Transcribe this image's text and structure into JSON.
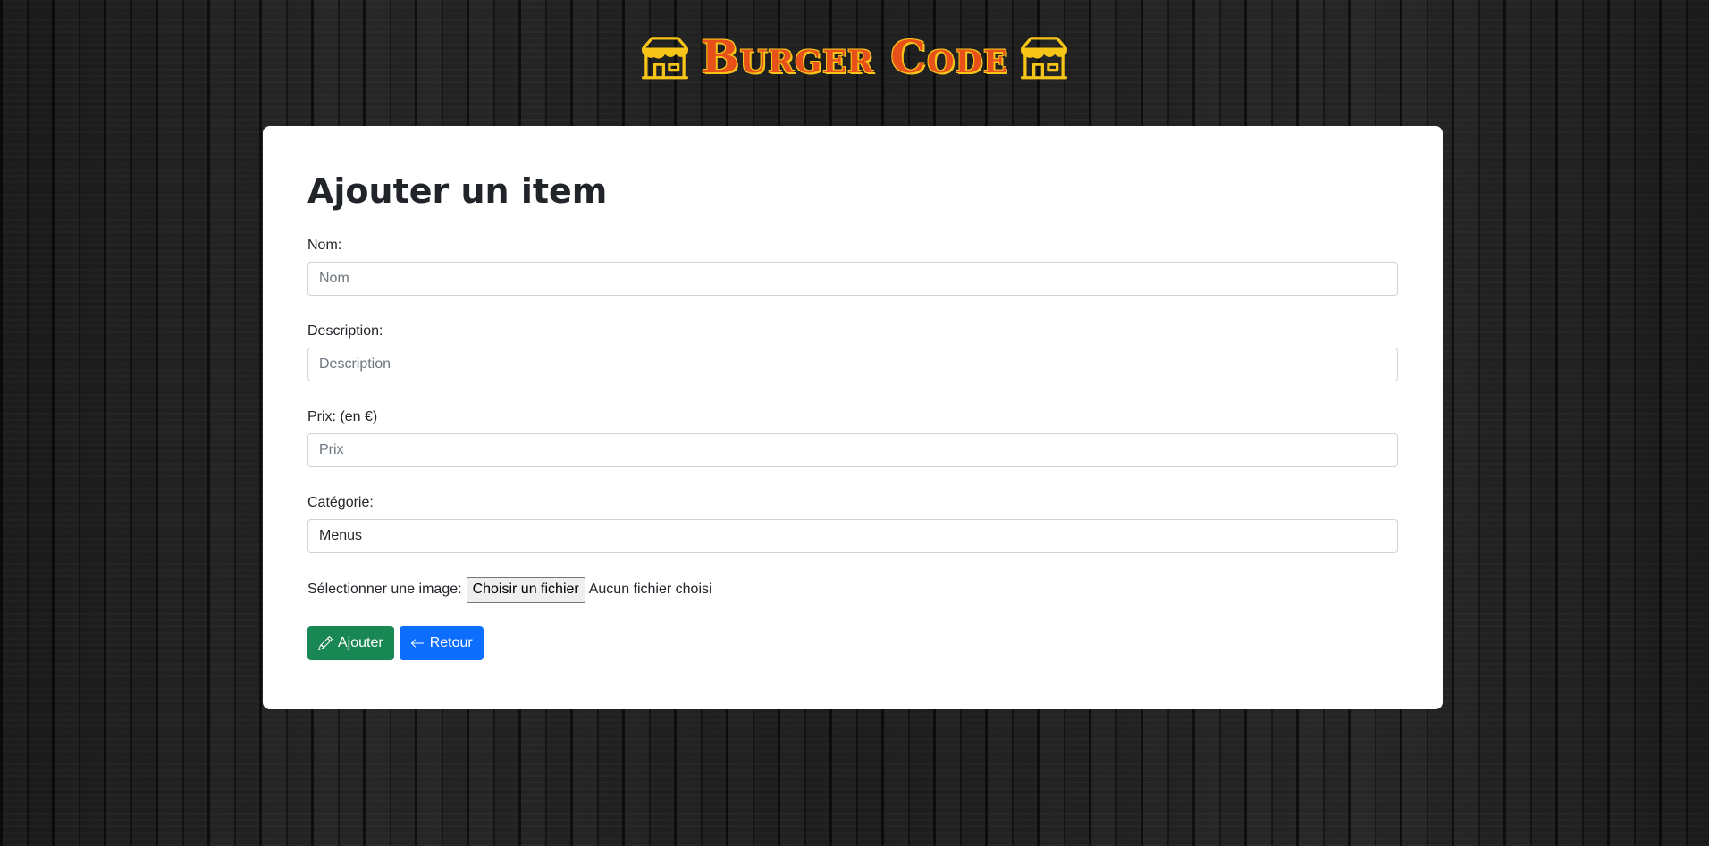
{
  "header": {
    "brand": "Burger Code",
    "left_icon": "shop-icon",
    "right_icon": "shop-icon",
    "brand_color": "#e8501a",
    "icon_color": "#f7c518"
  },
  "form": {
    "title": "Ajouter un item",
    "name_label": "Nom:",
    "name_placeholder": "Nom",
    "description_label": "Description:",
    "description_placeholder": "Description",
    "price_label": "Prix: (en €)",
    "price_placeholder": "Prix",
    "category_label": "Catégorie:",
    "category_value": "Menus",
    "image_label": "Sélectionner une image:",
    "file_button": "Choisir un fichier",
    "file_status": "Aucun fichier choisi",
    "submit_label": "Ajouter",
    "submit_icon": "pencil-icon",
    "back_label": "Retour",
    "back_icon": "arrow-left-icon"
  },
  "colors": {
    "success": "#198754",
    "primary": "#0d6efd"
  }
}
